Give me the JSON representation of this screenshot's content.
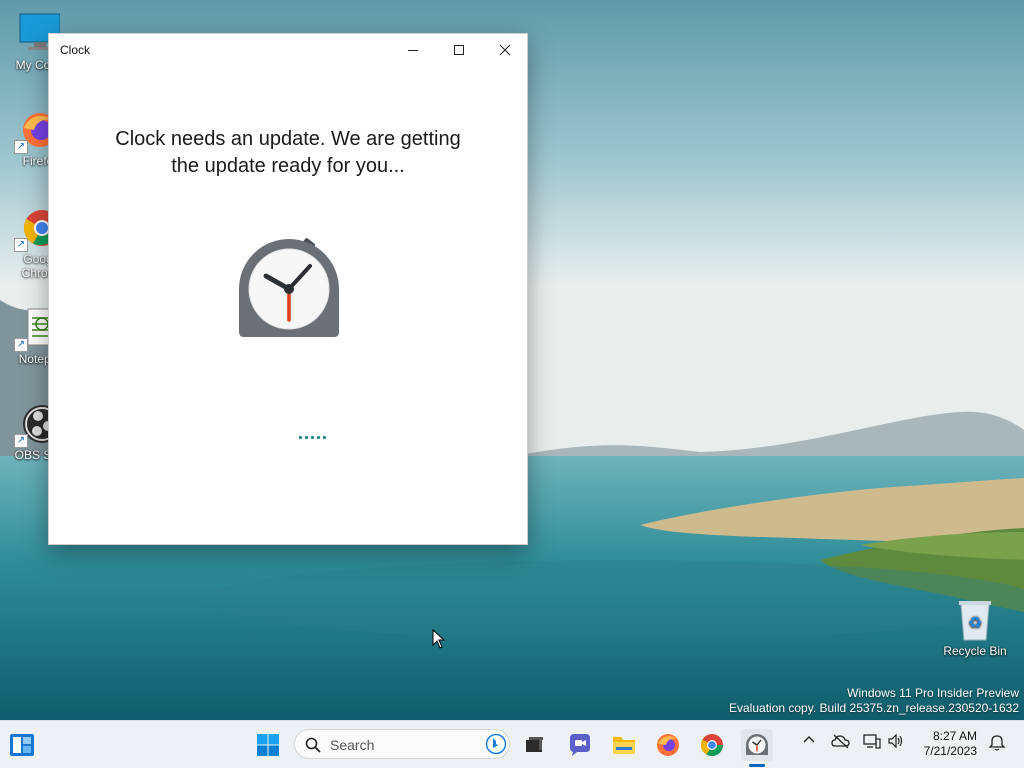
{
  "desktop": {
    "icons": [
      {
        "label": "My Com",
        "icon": "computer-icon"
      },
      {
        "label": "Firefo",
        "icon": "firefox-icon"
      },
      {
        "label": "Goog",
        "label2": "Chron",
        "icon": "chrome-icon"
      },
      {
        "label": "Notepa",
        "icon": "notepad-icon"
      },
      {
        "label": "OBS Stu",
        "icon": "obs-icon"
      }
    ],
    "recycle_bin": {
      "label": "Recycle Bin",
      "icon": "recycle-bin-icon"
    },
    "watermark": {
      "line1": "Windows 11 Pro Insider Preview",
      "line2": "Evaluation copy. Build 25375.zn_release.230520-1632"
    }
  },
  "window": {
    "title": "Clock",
    "minimize_icon": "minimize-icon",
    "maximize_icon": "maximize-icon",
    "close_icon": "close-icon",
    "message_line1": "Clock needs an update. We are getting",
    "message_line2": "the update ready for you...",
    "app_icon": "stopwatch-clock-icon",
    "accent": "#007d8a"
  },
  "taskbar": {
    "widgets_icon": "widgets-icon",
    "start_icon": "windows-start-icon",
    "search": {
      "placeholder": "Search",
      "bing_icon": "bing-icon"
    },
    "pinned": [
      "task-view-icon",
      "chat-icon",
      "file-explorer-icon",
      "firefox-icon",
      "chrome-icon",
      "clock-app-icon"
    ],
    "tray": {
      "chevron": "chevron-up-icon",
      "onedrive": "onedrive-icon",
      "network": "network-icon",
      "volume": "volume-icon",
      "time": "8:27 AM",
      "date": "7/21/2023",
      "notification": "notification-icon"
    }
  }
}
